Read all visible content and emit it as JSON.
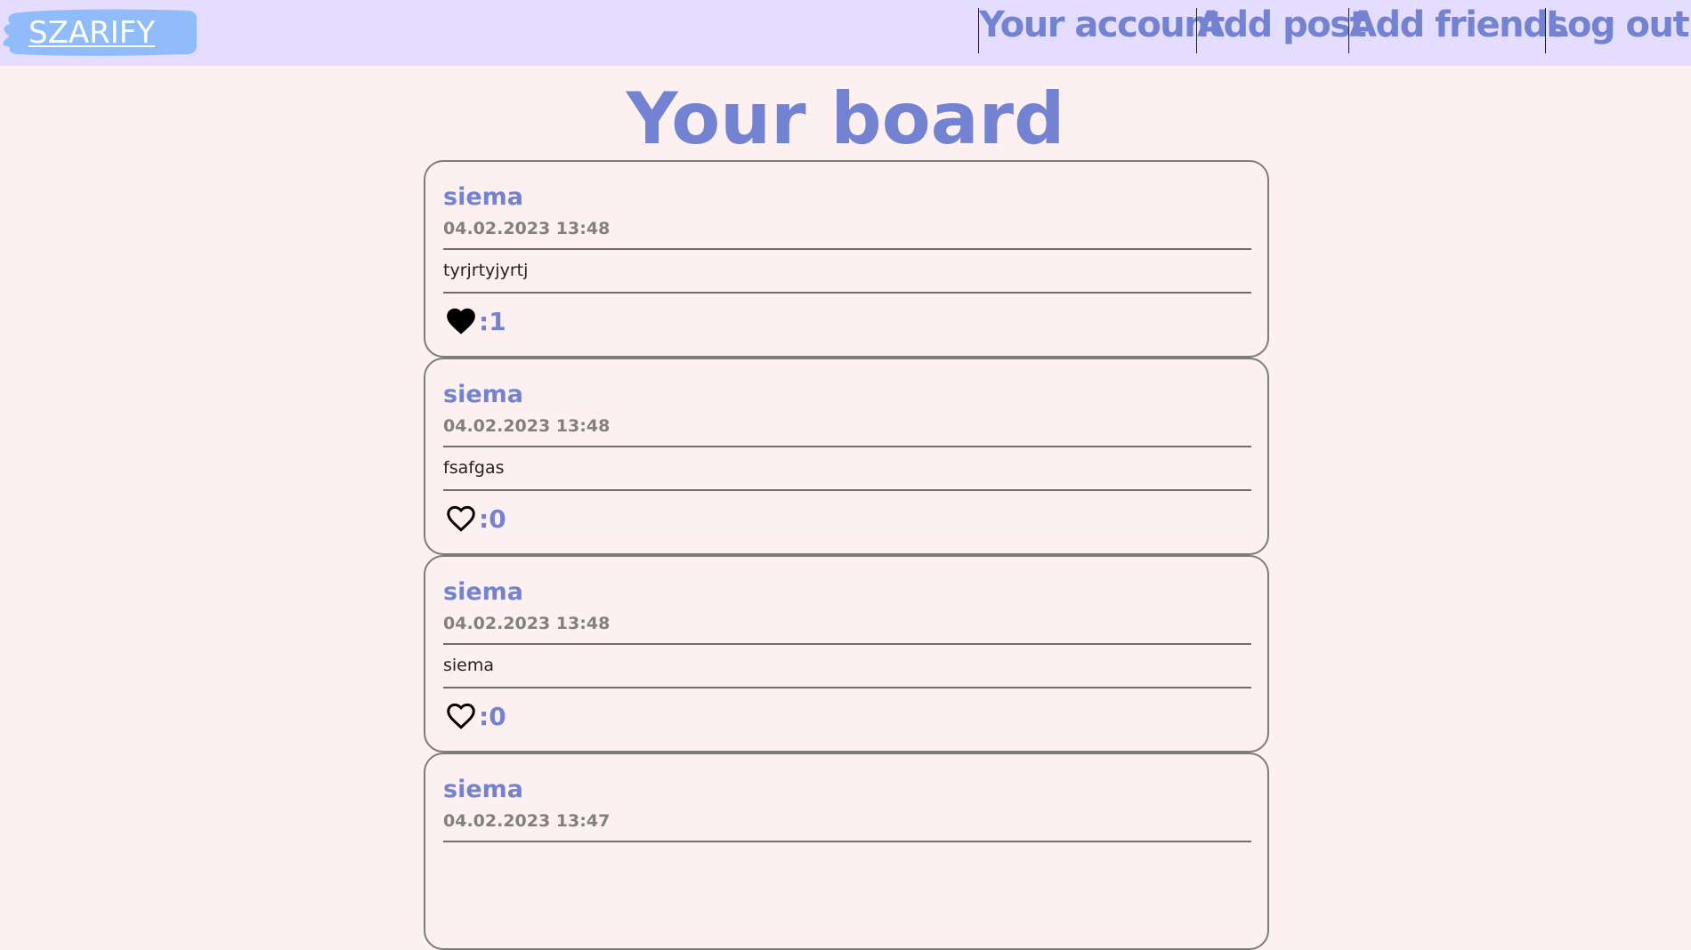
{
  "header": {
    "logo_text": "SZARIFY",
    "nav": {
      "your_account": "Your account",
      "add_post": "Add post",
      "add_friends": "Add friends",
      "log_out": "Log out"
    }
  },
  "main": {
    "title": "Your board",
    "posts": [
      {
        "author": "siema",
        "date": "04.02.2023 13:48",
        "body": "tyrjrtyjyrtj",
        "likes": ":1",
        "liked": true
      },
      {
        "author": "siema",
        "date": "04.02.2023 13:48",
        "body": "fsafgas",
        "likes": ":0",
        "liked": false
      },
      {
        "author": "siema",
        "date": "04.02.2023 13:48",
        "body": "siema",
        "likes": ":0",
        "liked": false
      },
      {
        "author": "siema",
        "date": "04.02.2023 13:47",
        "body": "",
        "likes": "",
        "liked": false
      }
    ]
  },
  "colors": {
    "accent": "#7483d1",
    "header_bg": "#e4ddfd",
    "page_bg": "#fdf0f1",
    "logo_bg": "#91bcfb"
  },
  "icons": {
    "heart_filled": "heart-filled-icon",
    "heart_outline": "heart-outline-icon"
  }
}
